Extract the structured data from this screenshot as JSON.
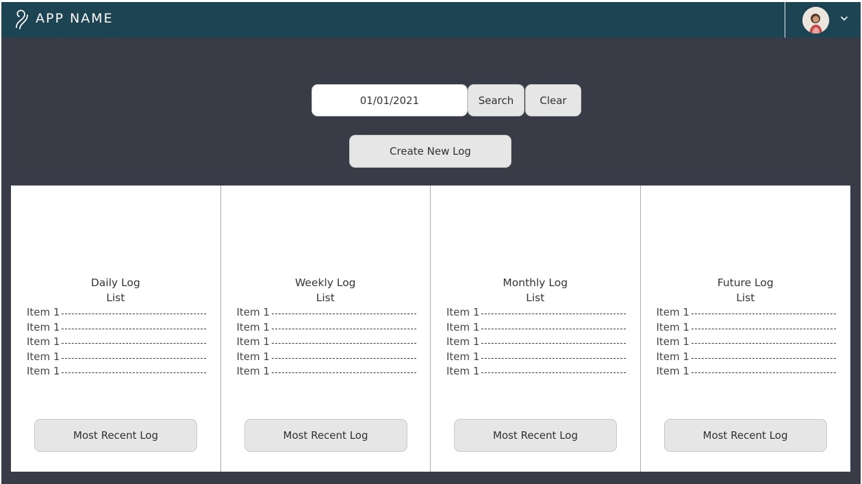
{
  "header": {
    "app_name": "APP NAME"
  },
  "search": {
    "date_value": "01/01/2021",
    "search_label": "Search",
    "clear_label": "Clear"
  },
  "create_button_label": "Create New Log",
  "panels": [
    {
      "title": "Daily Log",
      "subtitle": "List",
      "items": [
        "Item 1",
        "Item 1",
        "Item 1",
        "Item 1",
        "Item 1"
      ],
      "button_label": "Most Recent Log"
    },
    {
      "title": "Weekly Log",
      "subtitle": "List",
      "items": [
        "Item 1",
        "Item 1",
        "Item 1",
        "Item 1",
        "Item 1"
      ],
      "button_label": "Most Recent Log"
    },
    {
      "title": "Monthly Log",
      "subtitle": "List",
      "items": [
        "Item 1",
        "Item 1",
        "Item 1",
        "Item 1",
        "Item 1"
      ],
      "button_label": "Most Recent Log"
    },
    {
      "title": "Future Log",
      "subtitle": "List",
      "items": [
        "Item 1",
        "Item 1",
        "Item 1",
        "Item 1",
        "Item 1"
      ],
      "button_label": "Most Recent Log"
    }
  ],
  "colors": {
    "header_bg": "#1c4453",
    "page_bg": "#393c47",
    "button_bg": "#e6e6e6",
    "panel_bg": "#ffffff"
  },
  "icons": {
    "logo": "app-logo-icon",
    "avatar": "user-avatar",
    "caret": "chevron-down-icon"
  }
}
